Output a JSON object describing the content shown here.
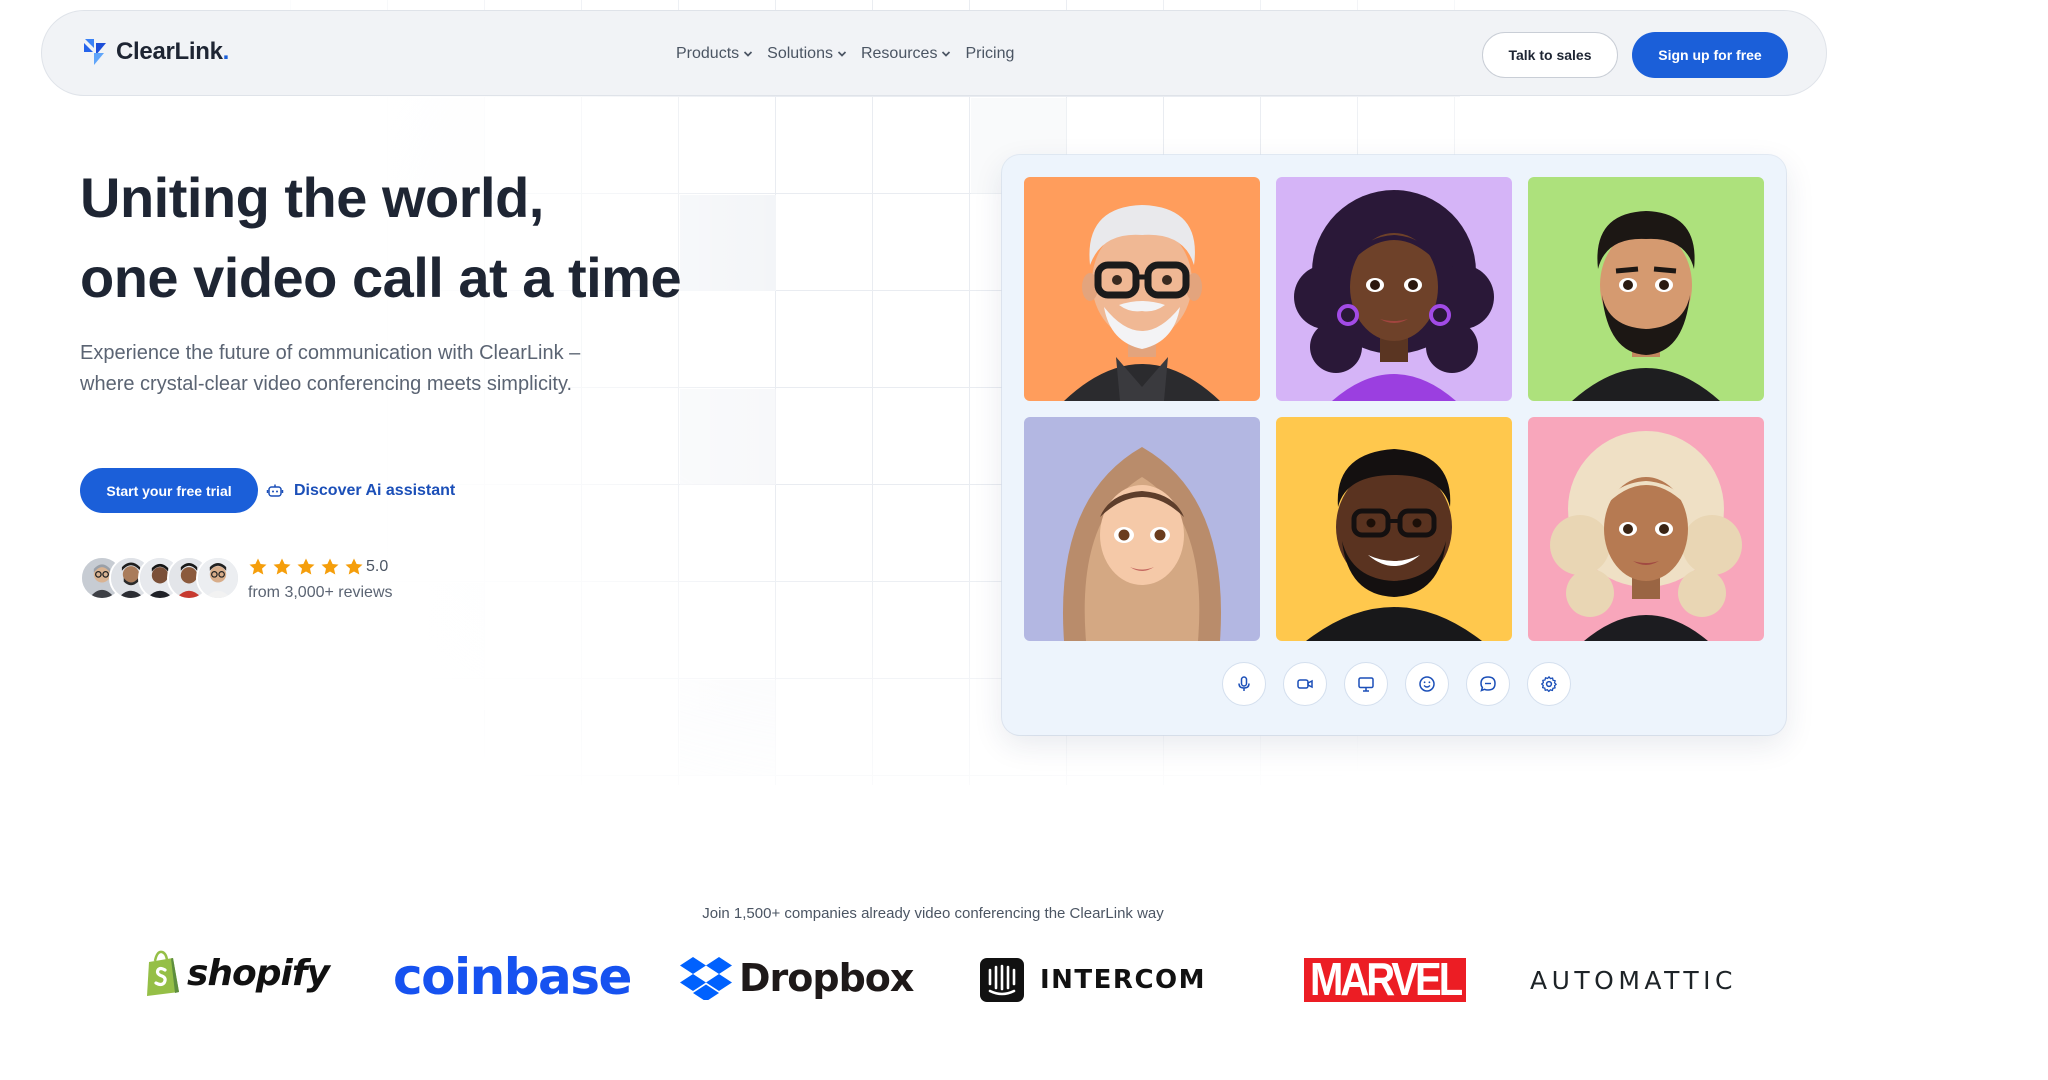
{
  "nav": {
    "brand": "ClearLink",
    "brand_dot": ".",
    "links": [
      "Products",
      "Solutions",
      "Resources",
      "Pricing"
    ],
    "talk_to_sales": "Talk to sales",
    "sign_up": "Sign up for free"
  },
  "hero": {
    "title_line1": "Uniting the world,",
    "title_line2": "one video call at a time",
    "subtitle": "Experience the future of communication with ClearLink – where crystal-clear video conferencing meets simplicity.",
    "cta_primary": "Start your free trial",
    "cta_secondary": "Discover Ai assistant",
    "rating": "5.0",
    "rating_stars": 5,
    "reviews": "from 3,000+ reviews"
  },
  "video": {
    "participants": [
      "participant-1",
      "participant-2",
      "participant-3",
      "participant-4",
      "participant-5",
      "participant-6"
    ],
    "tile_colors": [
      "#ff9d5c",
      "#d5b4f7",
      "#ade17c",
      "#b3b7e2",
      "#ffc84d",
      "#f8a6bb"
    ],
    "controls": [
      "microphone-icon",
      "camera-icon",
      "screen-share-icon",
      "emoji-icon",
      "chat-icon",
      "settings-icon"
    ]
  },
  "trusted": {
    "text": "Join 1,500+ companies already video conferencing the ClearLink way",
    "logos": [
      "shopify",
      "coinbase",
      "Dropbox",
      "INTERCOM",
      "MARVEL",
      "AUTOMATTIC"
    ]
  },
  "colors": {
    "primary": "#1b5fd9",
    "text_dark": "#1e2533",
    "star": "#f59e0b"
  }
}
